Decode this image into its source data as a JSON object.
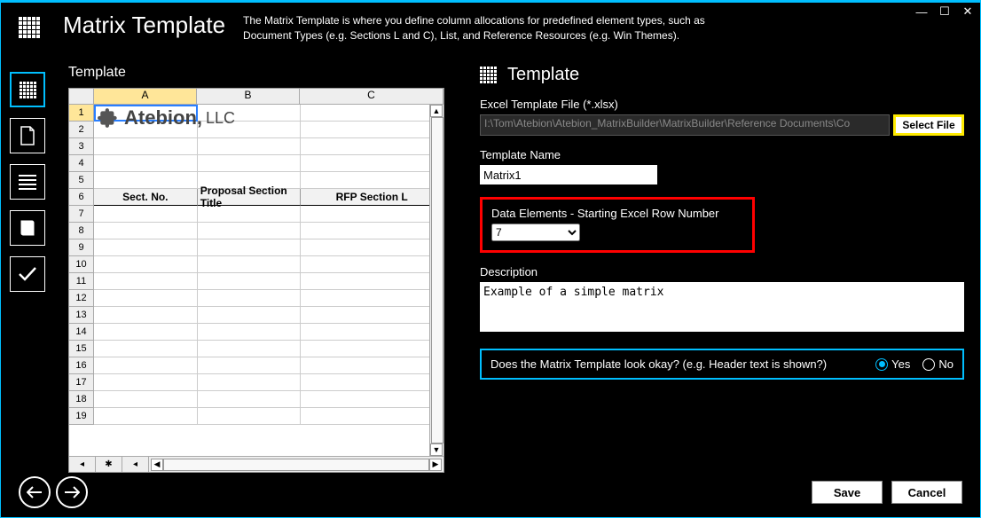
{
  "header": {
    "title": "Matrix Template",
    "description": "The Matrix Template is where you define column allocations for predefined element types, such as Document Types (e.g. Sections L and C), List, and Reference Resources (e.g. Win Themes)."
  },
  "leftPane": {
    "label": "Template",
    "columns": [
      "A",
      "B",
      "C"
    ],
    "logo_text": "Atebion,",
    "logo_suffix": "LLC",
    "tableHeaders": [
      "Sect. No.",
      "Proposal Section Title",
      "RFP Section L"
    ],
    "tableHeaderRow": 6,
    "rowCount": 19
  },
  "rightPane": {
    "title": "Template",
    "labels": {
      "file": "Excel Template File (*.xlsx)",
      "name": "Template Name",
      "startRow": "Data Elements - Starting Excel Row Number",
      "description": "Description",
      "confirm": "Does the Matrix Template look okay? (e.g. Header text is shown?)"
    },
    "values": {
      "filePath": "I:\\Tom\\Atebion\\Atebion_MatrixBuilder\\MatrixBuilder\\Reference Documents\\Co",
      "templateName": "Matrix1",
      "startRow": "7",
      "description": "Example of a simple matrix"
    },
    "buttons": {
      "selectFile": "Select File"
    },
    "radios": {
      "yes": "Yes",
      "no": "No",
      "selected": "yes"
    }
  },
  "footer": {
    "save": "Save",
    "cancel": "Cancel"
  }
}
